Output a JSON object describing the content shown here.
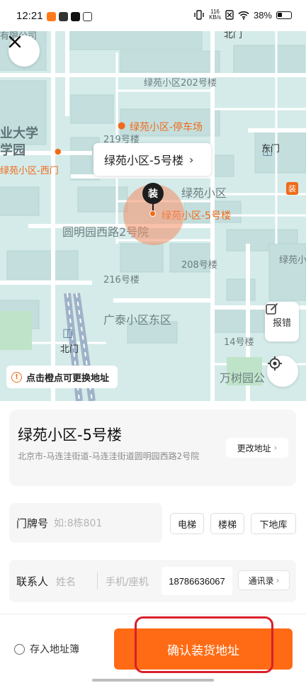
{
  "status_bar": {
    "time": "12:21",
    "net_speed_value": "116",
    "net_speed_unit": "KB/s",
    "battery": "38%"
  },
  "map": {
    "labels": {
      "univ_part1": "业大学",
      "univ_part2": "学园",
      "top_cut": "有限公司",
      "north_gate_top": "北门",
      "b202": "绿苑小区202号楼",
      "b219": "219号楼",
      "parking": "绿苑小区-停车场",
      "west_gate": "绿苑小区-西门",
      "east_gate": "东门",
      "lvyuan": "绿苑小区",
      "selected_poi": "绿苑小区-5号楼",
      "yuanmingyuan": "圆明园西路2号院",
      "b208": "208号楼",
      "b216": "216号楼",
      "guangtai": "广泰小区东区",
      "b14": "14号楼",
      "north_gate_bottom": "北门",
      "wanshu": "万树园公",
      "lvyuan_right": "绿苑小",
      "jiang": "装"
    },
    "callout_text": "绿苑小区-5号楼",
    "pin_label": "装",
    "report_label": "报错",
    "tip_text": "点击橙点可更换地址"
  },
  "address": {
    "title": "绿苑小区-5号楼",
    "detail": "北京市-马连洼街道-马连洼街道圆明园西路2号院",
    "change_label": "更改地址"
  },
  "door": {
    "label": "门牌号",
    "placeholder": "如:8栋801",
    "chips": [
      "电梯",
      "楼梯",
      "下地库"
    ]
  },
  "contact": {
    "label": "联系人",
    "name_placeholder": "姓名",
    "phone_placeholder": "手机/座机",
    "phone_value": "18786636067",
    "contacts_label": "通讯录"
  },
  "footer": {
    "save_label": "存入地址簿",
    "confirm_label": "确认装货地址"
  },
  "colors": {
    "accent": "#ff6b14",
    "map_bg": "#d4ebe9",
    "highlight_outline": "#d9202a"
  }
}
